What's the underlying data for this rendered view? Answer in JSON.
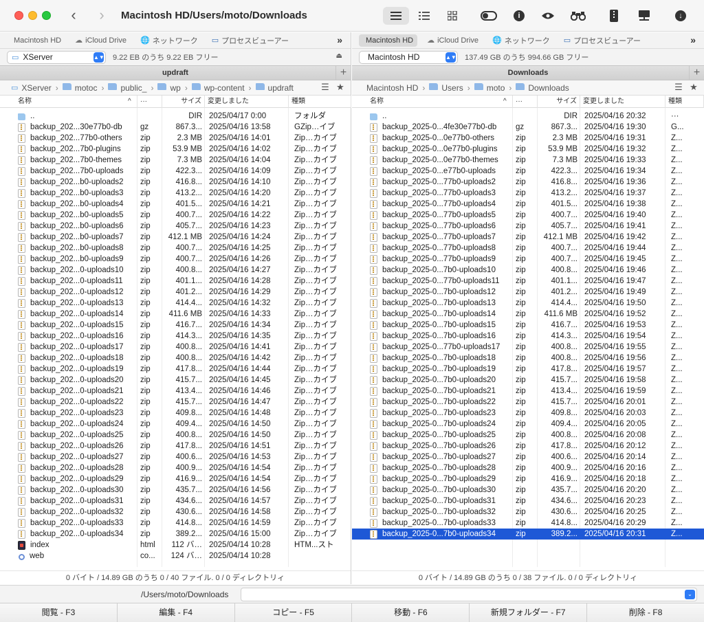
{
  "window": {
    "title": "Macintosh HD/Users/moto/Downloads",
    "back_arrow": "‹",
    "forward_arrow": "›"
  },
  "toolbar": {
    "icons": [
      "list-view-icon",
      "detail-view-icon",
      "grid-view-icon",
      "hidden-files-toggle-icon",
      "info-icon",
      "preview-eye-icon",
      "binoculars-icon",
      "archive-icon",
      "network-drive-icon",
      "download-icon"
    ],
    "info_glyph": "i",
    "download_glyph": "↓"
  },
  "favorites": [
    {
      "label": "Macintosh HD",
      "icon": "apple-icon",
      "glyph": ""
    },
    {
      "label": "iCloud Drive",
      "icon": "cloud-icon",
      "glyph": "☁"
    },
    {
      "label": "ネットワーク",
      "icon": "globe-icon",
      "glyph": "🌐"
    },
    {
      "label": "プロセスビューアー",
      "icon": "monitor-icon",
      "glyph": "▭"
    }
  ],
  "favorites_more": "»",
  "left_pane": {
    "volume": "XServer",
    "volume_glyph": "▭",
    "free_space": "9.22 EB のうち 9.22 EB フリー",
    "eject_glyph": "⏏",
    "title": "updraft",
    "breadcrumb": [
      "XServer",
      "motoc",
      "public_",
      "wp",
      "wp-content",
      "updraft"
    ],
    "columns": {
      "name": "名称",
      "ext": "···",
      "size": "サイズ",
      "modified": "変更しました",
      "kind": "種類"
    },
    "rows": [
      {
        "name": "..",
        "ext": "",
        "size": "DIR",
        "date": "2025/04/17 0:00",
        "kind": "フォルダ",
        "icon": "folder"
      },
      {
        "name": "backup_202...30e77b0-db",
        "ext": "gz",
        "size": "867.3...",
        "date": "2025/04/16 13:58",
        "kind": "GZip…イブ",
        "icon": "zip"
      },
      {
        "name": "backup_202...77b0-others",
        "ext": "zip",
        "size": "2.3 MB",
        "date": "2025/04/16 14:01",
        "kind": "Zip…カイブ",
        "icon": "zip"
      },
      {
        "name": "backup_202...7b0-plugins",
        "ext": "zip",
        "size": "53.9 MB",
        "date": "2025/04/16 14:02",
        "kind": "Zip…カイブ",
        "icon": "zip"
      },
      {
        "name": "backup_202...7b0-themes",
        "ext": "zip",
        "size": "7.3 MB",
        "date": "2025/04/16 14:04",
        "kind": "Zip…カイブ",
        "icon": "zip"
      },
      {
        "name": "backup_202...7b0-uploads",
        "ext": "zip",
        "size": "422.3...",
        "date": "2025/04/16 14:09",
        "kind": "Zip…カイブ",
        "icon": "zip"
      },
      {
        "name": "backup_202...b0-uploads2",
        "ext": "zip",
        "size": "416.8...",
        "date": "2025/04/16 14:10",
        "kind": "Zip…カイブ",
        "icon": "zip"
      },
      {
        "name": "backup_202...b0-uploads3",
        "ext": "zip",
        "size": "413.2...",
        "date": "2025/04/16 14:20",
        "kind": "Zip…カイブ",
        "icon": "zip"
      },
      {
        "name": "backup_202...b0-uploads4",
        "ext": "zip",
        "size": "401.5...",
        "date": "2025/04/16 14:21",
        "kind": "Zip…カイブ",
        "icon": "zip"
      },
      {
        "name": "backup_202...b0-uploads5",
        "ext": "zip",
        "size": "400.7...",
        "date": "2025/04/16 14:22",
        "kind": "Zip…カイブ",
        "icon": "zip"
      },
      {
        "name": "backup_202...b0-uploads6",
        "ext": "zip",
        "size": "405.7...",
        "date": "2025/04/16 14:23",
        "kind": "Zip…カイブ",
        "icon": "zip"
      },
      {
        "name": "backup_202...b0-uploads7",
        "ext": "zip",
        "size": "412.1 MB",
        "date": "2025/04/16 14:24",
        "kind": "Zip…カイブ",
        "icon": "zip"
      },
      {
        "name": "backup_202...b0-uploads8",
        "ext": "zip",
        "size": "400.7...",
        "date": "2025/04/16 14:25",
        "kind": "Zip…カイブ",
        "icon": "zip"
      },
      {
        "name": "backup_202...b0-uploads9",
        "ext": "zip",
        "size": "400.7...",
        "date": "2025/04/16 14:26",
        "kind": "Zip…カイブ",
        "icon": "zip"
      },
      {
        "name": "backup_202...0-uploads10",
        "ext": "zip",
        "size": "400.8...",
        "date": "2025/04/16 14:27",
        "kind": "Zip…カイブ",
        "icon": "zip"
      },
      {
        "name": "backup_202...0-uploads11",
        "ext": "zip",
        "size": "401.1...",
        "date": "2025/04/16 14:28",
        "kind": "Zip…カイブ",
        "icon": "zip"
      },
      {
        "name": "backup_202...0-uploads12",
        "ext": "zip",
        "size": "401.2...",
        "date": "2025/04/16 14:29",
        "kind": "Zip…カイブ",
        "icon": "zip"
      },
      {
        "name": "backup_202...0-uploads13",
        "ext": "zip",
        "size": "414.4...",
        "date": "2025/04/16 14:32",
        "kind": "Zip…カイブ",
        "icon": "zip"
      },
      {
        "name": "backup_202...0-uploads14",
        "ext": "zip",
        "size": "411.6 MB",
        "date": "2025/04/16 14:33",
        "kind": "Zip…カイブ",
        "icon": "zip"
      },
      {
        "name": "backup_202...0-uploads15",
        "ext": "zip",
        "size": "416.7...",
        "date": "2025/04/16 14:34",
        "kind": "Zip…カイブ",
        "icon": "zip"
      },
      {
        "name": "backup_202...0-uploads16",
        "ext": "zip",
        "size": "414.3...",
        "date": "2025/04/16 14:35",
        "kind": "Zip…カイブ",
        "icon": "zip"
      },
      {
        "name": "backup_202...0-uploads17",
        "ext": "zip",
        "size": "400.8...",
        "date": "2025/04/16 14:41",
        "kind": "Zip…カイブ",
        "icon": "zip"
      },
      {
        "name": "backup_202...0-uploads18",
        "ext": "zip",
        "size": "400.8...",
        "date": "2025/04/16 14:42",
        "kind": "Zip…カイブ",
        "icon": "zip"
      },
      {
        "name": "backup_202...0-uploads19",
        "ext": "zip",
        "size": "417.8...",
        "date": "2025/04/16 14:44",
        "kind": "Zip…カイブ",
        "icon": "zip"
      },
      {
        "name": "backup_202...0-uploads20",
        "ext": "zip",
        "size": "415.7...",
        "date": "2025/04/16 14:45",
        "kind": "Zip…カイブ",
        "icon": "zip"
      },
      {
        "name": "backup_202...0-uploads21",
        "ext": "zip",
        "size": "413.4...",
        "date": "2025/04/16 14:46",
        "kind": "Zip…カイブ",
        "icon": "zip"
      },
      {
        "name": "backup_202...0-uploads22",
        "ext": "zip",
        "size": "415.7...",
        "date": "2025/04/16 14:47",
        "kind": "Zip…カイブ",
        "icon": "zip"
      },
      {
        "name": "backup_202...0-uploads23",
        "ext": "zip",
        "size": "409.8...",
        "date": "2025/04/16 14:48",
        "kind": "Zip…カイブ",
        "icon": "zip"
      },
      {
        "name": "backup_202...0-uploads24",
        "ext": "zip",
        "size": "409.4...",
        "date": "2025/04/16 14:50",
        "kind": "Zip…カイブ",
        "icon": "zip"
      },
      {
        "name": "backup_202...0-uploads25",
        "ext": "zip",
        "size": "400.8...",
        "date": "2025/04/16 14:50",
        "kind": "Zip…カイブ",
        "icon": "zip"
      },
      {
        "name": "backup_202...0-uploads26",
        "ext": "zip",
        "size": "417.8...",
        "date": "2025/04/16 14:51",
        "kind": "Zip…カイブ",
        "icon": "zip"
      },
      {
        "name": "backup_202...0-uploads27",
        "ext": "zip",
        "size": "400.6...",
        "date": "2025/04/16 14:53",
        "kind": "Zip…カイブ",
        "icon": "zip"
      },
      {
        "name": "backup_202...0-uploads28",
        "ext": "zip",
        "size": "400.9...",
        "date": "2025/04/16 14:54",
        "kind": "Zip…カイブ",
        "icon": "zip"
      },
      {
        "name": "backup_202...0-uploads29",
        "ext": "zip",
        "size": "416.9...",
        "date": "2025/04/16 14:54",
        "kind": "Zip…カイブ",
        "icon": "zip"
      },
      {
        "name": "backup_202...0-uploads30",
        "ext": "zip",
        "size": "435.7...",
        "date": "2025/04/16 14:56",
        "kind": "Zip…カイブ",
        "icon": "zip"
      },
      {
        "name": "backup_202...0-uploads31",
        "ext": "zip",
        "size": "434.6...",
        "date": "2025/04/16 14:57",
        "kind": "Zip…カイブ",
        "icon": "zip"
      },
      {
        "name": "backup_202...0-uploads32",
        "ext": "zip",
        "size": "430.6...",
        "date": "2025/04/16 14:58",
        "kind": "Zip…カイブ",
        "icon": "zip"
      },
      {
        "name": "backup_202...0-uploads33",
        "ext": "zip",
        "size": "414.8...",
        "date": "2025/04/16 14:59",
        "kind": "Zip…カイブ",
        "icon": "zip"
      },
      {
        "name": "backup_202...0-uploads34",
        "ext": "zip",
        "size": "389.2...",
        "date": "2025/04/16 15:00",
        "kind": "Zip…カイブ",
        "icon": "zip"
      },
      {
        "name": "index",
        "ext": "html",
        "size": "112 バ…",
        "date": "2025/04/14 10:28",
        "kind": "HTM...スト",
        "icon": "html"
      },
      {
        "name": "web",
        "ext": "co...",
        "size": "124 バ…",
        "date": "2025/04/14 10:28",
        "kind": "",
        "icon": "web"
      }
    ],
    "status": "0 バイト / 14.89 GB のうち 0 / 40 ファイル. 0 / 0 ディレクトリィ"
  },
  "right_pane": {
    "volume": "Macintosh HD",
    "volume_glyph": "",
    "free_space": "137.49 GB のうち 994.66 GB フリー",
    "title": "Downloads",
    "breadcrumb": [
      "Macintosh HD",
      "Users",
      "moto",
      "Downloads"
    ],
    "columns": {
      "name": "名称",
      "ext": "···",
      "size": "サイズ",
      "modified": "変更しました",
      "kind": "種類"
    },
    "rows": [
      {
        "name": "..",
        "ext": "",
        "size": "DIR",
        "date": "2025/04/16 20:32",
        "kind": "···",
        "icon": "folder"
      },
      {
        "name": "backup_2025-0...4fe30e77b0-db",
        "ext": "gz",
        "size": "867.3...",
        "date": "2025/04/16 19:30",
        "kind": "G...",
        "icon": "zip"
      },
      {
        "name": "backup_2025-0...0e77b0-others",
        "ext": "zip",
        "size": "2.3 MB",
        "date": "2025/04/16 19:31",
        "kind": "Z...",
        "icon": "zip"
      },
      {
        "name": "backup_2025-0...0e77b0-plugins",
        "ext": "zip",
        "size": "53.9 MB",
        "date": "2025/04/16 19:32",
        "kind": "Z...",
        "icon": "zip"
      },
      {
        "name": "backup_2025-0...0e77b0-themes",
        "ext": "zip",
        "size": "7.3 MB",
        "date": "2025/04/16 19:33",
        "kind": "Z...",
        "icon": "zip"
      },
      {
        "name": "backup_2025-0...e77b0-uploads",
        "ext": "zip",
        "size": "422.3...",
        "date": "2025/04/16 19:34",
        "kind": "Z...",
        "icon": "zip"
      },
      {
        "name": "backup_2025-0...77b0-uploads2",
        "ext": "zip",
        "size": "416.8...",
        "date": "2025/04/16 19:36",
        "kind": "Z...",
        "icon": "zip"
      },
      {
        "name": "backup_2025-0...77b0-uploads3",
        "ext": "zip",
        "size": "413.2...",
        "date": "2025/04/16 19:37",
        "kind": "Z...",
        "icon": "zip"
      },
      {
        "name": "backup_2025-0...77b0-uploads4",
        "ext": "zip",
        "size": "401.5...",
        "date": "2025/04/16 19:38",
        "kind": "Z...",
        "icon": "zip"
      },
      {
        "name": "backup_2025-0...77b0-uploads5",
        "ext": "zip",
        "size": "400.7...",
        "date": "2025/04/16 19:40",
        "kind": "Z...",
        "icon": "zip"
      },
      {
        "name": "backup_2025-0...77b0-uploads6",
        "ext": "zip",
        "size": "405.7...",
        "date": "2025/04/16 19:41",
        "kind": "Z...",
        "icon": "zip"
      },
      {
        "name": "backup_2025-0...77b0-uploads7",
        "ext": "zip",
        "size": "412.1 MB",
        "date": "2025/04/16 19:42",
        "kind": "Z...",
        "icon": "zip"
      },
      {
        "name": "backup_2025-0...77b0-uploads8",
        "ext": "zip",
        "size": "400.7...",
        "date": "2025/04/16 19:44",
        "kind": "Z...",
        "icon": "zip"
      },
      {
        "name": "backup_2025-0...77b0-uploads9",
        "ext": "zip",
        "size": "400.7...",
        "date": "2025/04/16 19:45",
        "kind": "Z...",
        "icon": "zip"
      },
      {
        "name": "backup_2025-0...7b0-uploads10",
        "ext": "zip",
        "size": "400.8...",
        "date": "2025/04/16 19:46",
        "kind": "Z...",
        "icon": "zip"
      },
      {
        "name": "backup_2025-0...77b0-uploads11",
        "ext": "zip",
        "size": "401.1...",
        "date": "2025/04/16 19:47",
        "kind": "Z...",
        "icon": "zip"
      },
      {
        "name": "backup_2025-0...7b0-uploads12",
        "ext": "zip",
        "size": "401.2...",
        "date": "2025/04/16 19:49",
        "kind": "Z...",
        "icon": "zip"
      },
      {
        "name": "backup_2025-0...7b0-uploads13",
        "ext": "zip",
        "size": "414.4...",
        "date": "2025/04/16 19:50",
        "kind": "Z...",
        "icon": "zip"
      },
      {
        "name": "backup_2025-0...7b0-uploads14",
        "ext": "zip",
        "size": "411.6 MB",
        "date": "2025/04/16 19:52",
        "kind": "Z...",
        "icon": "zip"
      },
      {
        "name": "backup_2025-0...7b0-uploads15",
        "ext": "zip",
        "size": "416.7...",
        "date": "2025/04/16 19:53",
        "kind": "Z...",
        "icon": "zip"
      },
      {
        "name": "backup_2025-0...7b0-uploads16",
        "ext": "zip",
        "size": "414.3...",
        "date": "2025/04/16 19:54",
        "kind": "Z...",
        "icon": "zip"
      },
      {
        "name": "backup_2025-0...77b0-uploads17",
        "ext": "zip",
        "size": "400.8...",
        "date": "2025/04/16 19:55",
        "kind": "Z...",
        "icon": "zip"
      },
      {
        "name": "backup_2025-0...7b0-uploads18",
        "ext": "zip",
        "size": "400.8...",
        "date": "2025/04/16 19:56",
        "kind": "Z...",
        "icon": "zip"
      },
      {
        "name": "backup_2025-0...7b0-uploads19",
        "ext": "zip",
        "size": "417.8...",
        "date": "2025/04/16 19:57",
        "kind": "Z...",
        "icon": "zip"
      },
      {
        "name": "backup_2025-0...7b0-uploads20",
        "ext": "zip",
        "size": "415.7...",
        "date": "2025/04/16 19:58",
        "kind": "Z...",
        "icon": "zip"
      },
      {
        "name": "backup_2025-0...7b0-uploads21",
        "ext": "zip",
        "size": "413.4...",
        "date": "2025/04/16 19:59",
        "kind": "Z...",
        "icon": "zip"
      },
      {
        "name": "backup_2025-0...7b0-uploads22",
        "ext": "zip",
        "size": "415.7...",
        "date": "2025/04/16 20:01",
        "kind": "Z...",
        "icon": "zip"
      },
      {
        "name": "backup_2025-0...7b0-uploads23",
        "ext": "zip",
        "size": "409.8...",
        "date": "2025/04/16 20:03",
        "kind": "Z...",
        "icon": "zip"
      },
      {
        "name": "backup_2025-0...7b0-uploads24",
        "ext": "zip",
        "size": "409.4...",
        "date": "2025/04/16 20:05",
        "kind": "Z...",
        "icon": "zip"
      },
      {
        "name": "backup_2025-0...7b0-uploads25",
        "ext": "zip",
        "size": "400.8...",
        "date": "2025/04/16 20:08",
        "kind": "Z...",
        "icon": "zip"
      },
      {
        "name": "backup_2025-0...7b0-uploads26",
        "ext": "zip",
        "size": "417.8...",
        "date": "2025/04/16 20:12",
        "kind": "Z...",
        "icon": "zip"
      },
      {
        "name": "backup_2025-0...7b0-uploads27",
        "ext": "zip",
        "size": "400.6...",
        "date": "2025/04/16 20:14",
        "kind": "Z...",
        "icon": "zip"
      },
      {
        "name": "backup_2025-0...7b0-uploads28",
        "ext": "zip",
        "size": "400.9...",
        "date": "2025/04/16 20:16",
        "kind": "Z...",
        "icon": "zip"
      },
      {
        "name": "backup_2025-0...7b0-uploads29",
        "ext": "zip",
        "size": "416.9...",
        "date": "2025/04/16 20:18",
        "kind": "Z...",
        "icon": "zip"
      },
      {
        "name": "backup_2025-0...7b0-uploads30",
        "ext": "zip",
        "size": "435.7...",
        "date": "2025/04/16 20:20",
        "kind": "Z...",
        "icon": "zip"
      },
      {
        "name": "backup_2025-0...7b0-uploads31",
        "ext": "zip",
        "size": "434.6...",
        "date": "2025/04/16 20:23",
        "kind": "Z...",
        "icon": "zip"
      },
      {
        "name": "backup_2025-0...7b0-uploads32",
        "ext": "zip",
        "size": "430.6...",
        "date": "2025/04/16 20:25",
        "kind": "Z...",
        "icon": "zip"
      },
      {
        "name": "backup_2025-0...7b0-uploads33",
        "ext": "zip",
        "size": "414.8...",
        "date": "2025/04/16 20:29",
        "kind": "Z...",
        "icon": "zip"
      },
      {
        "name": "backup_2025-0...7b0-uploads34",
        "ext": "zip",
        "size": "389.2...",
        "date": "2025/04/16 20:31",
        "kind": "Z...",
        "icon": "zip",
        "selected": true
      }
    ],
    "status": "0 バイト / 14.89 GB のうち 0 / 38 ファイル. 0 / 0 ディレクトリィ"
  },
  "command_line": {
    "path": "/Users/moto/Downloads",
    "value": "",
    "dropdown_glyph": "⌄"
  },
  "function_keys": [
    "閲覧 - F3",
    "編集 - F4",
    "コピー - F5",
    "移動 - F6",
    "新規フォルダー - F7",
    "削除 - F8"
  ],
  "colors": {
    "selection": "#1e58d6",
    "accent": "#2f7cf6"
  }
}
